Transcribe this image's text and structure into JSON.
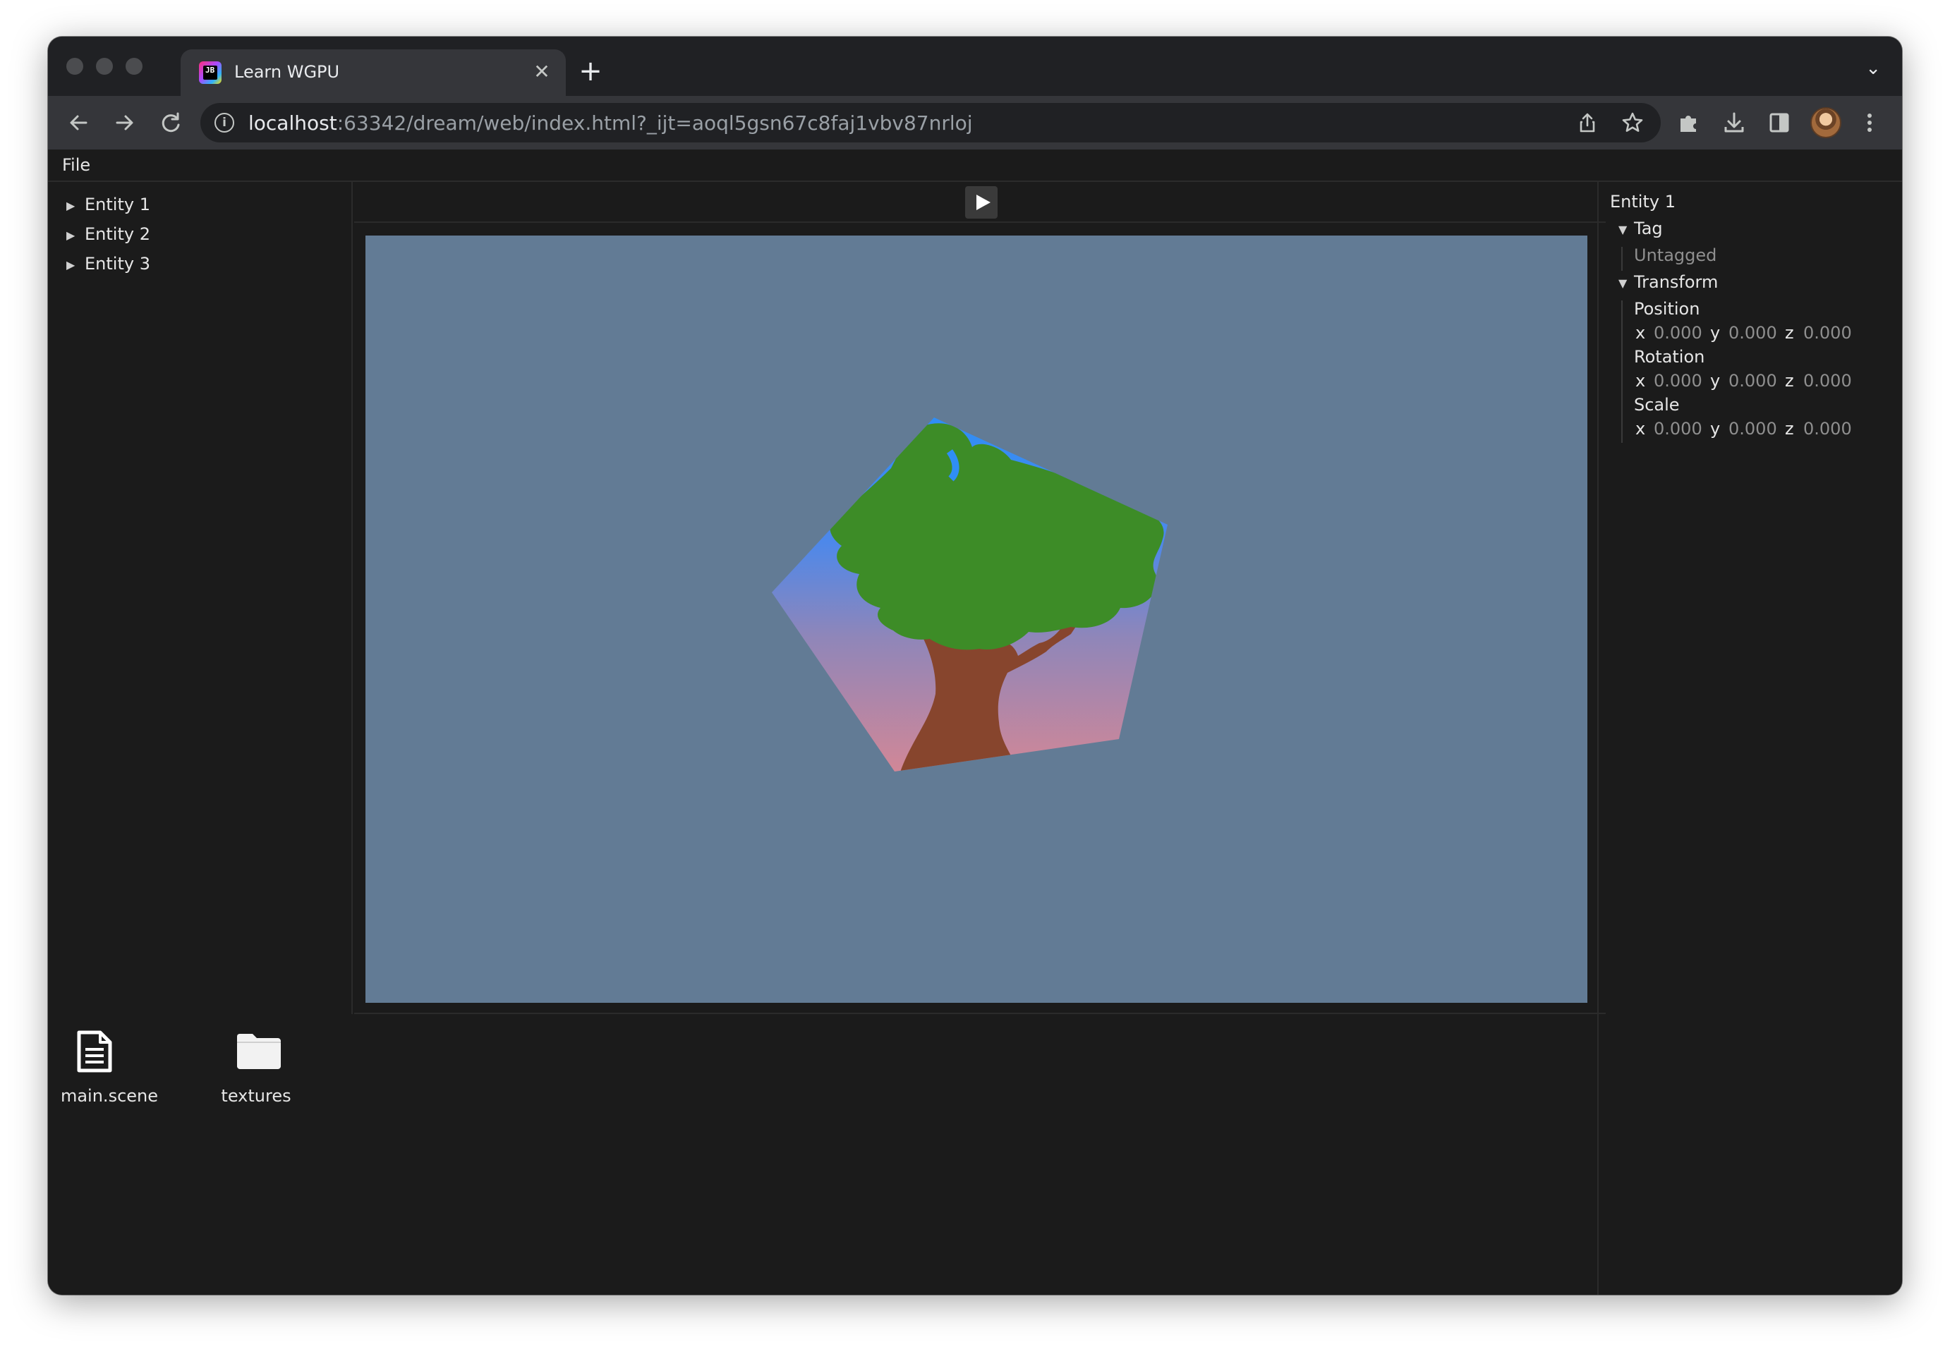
{
  "browser": {
    "tab": {
      "title": "Learn WGPU",
      "favicon_text": "JB"
    },
    "new_tab_symbol": "+",
    "close_symbol": "✕",
    "tab_list_symbol": "⌄",
    "url": {
      "host": "localhost",
      "rest": ":63342/dream/web/index.html?_ijt=aoql5gsn67c8faj1vbv87nrloj"
    },
    "icons": [
      "back-icon",
      "forward-icon",
      "reload-icon",
      "info-icon",
      "share-icon",
      "bookmark-star-icon",
      "extensions-icon",
      "download-icon",
      "side-panel-icon",
      "profile-avatar",
      "more-menu-icon"
    ]
  },
  "app": {
    "menu": {
      "file": "File"
    },
    "hierarchy": {
      "items": [
        {
          "label": "Entity 1"
        },
        {
          "label": "Entity 2"
        },
        {
          "label": "Entity 3"
        }
      ]
    },
    "viewport": {
      "background_color": "#627b95",
      "foliage_color": "#3d8c27",
      "trunk_color": "#87452d"
    },
    "inspector": {
      "entity_name": "Entity 1",
      "tag": {
        "header": "Tag",
        "value": "Untagged"
      },
      "transform": {
        "header": "Transform",
        "position": {
          "label": "Position",
          "x": "0.000",
          "y": "0.000",
          "z": "0.000"
        },
        "rotation": {
          "label": "Rotation",
          "x": "0.000",
          "y": "0.000",
          "z": "0.000"
        },
        "scale": {
          "label": "Scale",
          "x": "0.000",
          "y": "0.000",
          "z": "0.000"
        }
      },
      "axis_labels": {
        "x": "x",
        "y": "y",
        "z": "z"
      }
    },
    "assets": [
      {
        "label": "main.scene",
        "icon": "file-icon"
      },
      {
        "label": "textures",
        "icon": "folder-icon"
      }
    ]
  }
}
